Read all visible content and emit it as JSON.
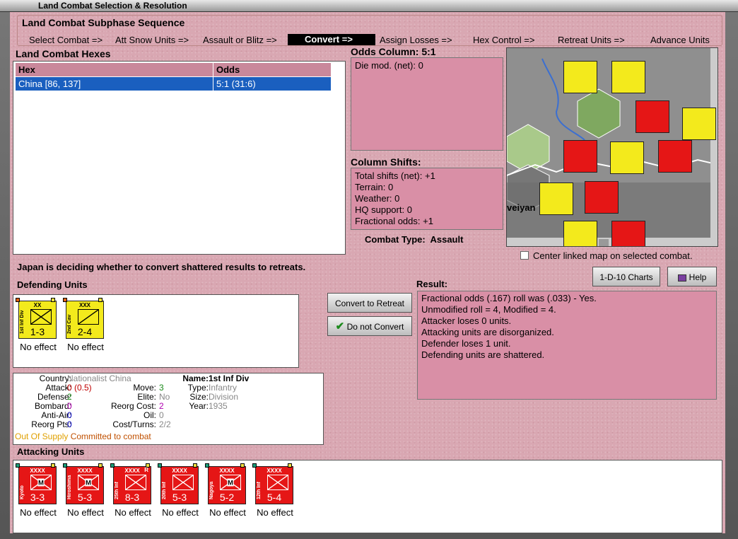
{
  "window": {
    "title": "Land Combat Selection & Resolution"
  },
  "sequence": {
    "title": "Land Combat Subphase Sequence",
    "steps": [
      "Select Combat =>",
      "Att Snow Units =>",
      "Assault or Blitz =>",
      "Convert =>",
      "Assign Losses =>",
      "Hex Control =>",
      "Retreat Units =>",
      "Advance Units"
    ],
    "current_index": 3
  },
  "hexes": {
    "title": "Land Combat Hexes",
    "col_hex": "Hex",
    "col_odds": "Odds",
    "rows": [
      {
        "hex": "China [86, 137]",
        "odds": "5:1 (31:6)"
      }
    ]
  },
  "odds": {
    "title": "Odds Column: 5:1",
    "die_mod": "Die mod. (net): 0"
  },
  "shifts": {
    "title": "Column Shifts:",
    "lines": [
      "Total shifts (net): +1",
      "Terrain: 0",
      "Weather: 0",
      "HQ support: 0",
      "Fractional odds: +1"
    ]
  },
  "combat_type": {
    "label": "Combat Type:",
    "value": "Assault"
  },
  "map": {
    "center_label": "Center linked map on selected combat.",
    "center_checked": false,
    "place_fragment": "veiyan"
  },
  "status_text": "Japan is deciding whether to convert shattered results to retreats.",
  "buttons": {
    "charts": "1-D-10 Charts",
    "help": "Help",
    "convert": "Convert to Retreat",
    "do_not_convert": "Do not Convert"
  },
  "defending": {
    "title": "Defending Units",
    "units": [
      {
        "name": "1st Inf Div",
        "size": "XX",
        "value": "1-3",
        "result": "No effect",
        "color": "yellow",
        "symbol": "inf"
      },
      {
        "name": "2nd Cav",
        "size": "XXX",
        "value": "2-4",
        "result": "No effect",
        "color": "yellow",
        "symbol": "cav"
      }
    ]
  },
  "details": {
    "country_label": "Country:",
    "country": "Nationalist China",
    "attack_label": "Attack:",
    "attack": "0 (0.5)",
    "defense_label": "Defense:",
    "defense": "2",
    "bombard_label": "Bombard:",
    "bombard": "0",
    "antiair_label": "Anti-Air:",
    "antiair": "0",
    "reorgpts_label": "Reorg Pts:",
    "reorgpts": "0",
    "move_label": "Move:",
    "move": "3",
    "elite_label": "Elite:",
    "elite": "No",
    "reorgcost_label": "Reorg Cost:",
    "reorgcost": "2",
    "oil_label": "Oil:",
    "oil": "0",
    "costturns_label": "Cost/Turns:",
    "costturns": "2/2",
    "name_label": "Name:",
    "name": "1st Inf Div",
    "type_label": "Type:",
    "type": "Infantry",
    "size_label": "Size:",
    "size": "Division",
    "year_label": "Year:",
    "year": "1935",
    "supply": "Out Of Supply",
    "committed": "Committed to combat"
  },
  "result": {
    "title": "Result:",
    "lines": [
      "Fractional odds (.167) roll was (.033)  - Yes.",
      "Unmodified roll = 4, Modified = 4.",
      "Attacker loses 0 units.",
      "Attacking units are disorganized.",
      "Defender loses 1 unit.",
      "Defending units are shattered."
    ]
  },
  "attacking": {
    "title": "Attacking Units",
    "units": [
      {
        "name": "Kyoto",
        "size": "XXXX",
        "value": "3-3",
        "result": "No effect",
        "symbol": "mech",
        "reserve": false
      },
      {
        "name": "Hiroshima",
        "size": "XXXX",
        "value": "5-3",
        "result": "No effect",
        "symbol": "mech",
        "reserve": false
      },
      {
        "name": "25th Inf",
        "size": "XXXX",
        "value": "8-3",
        "result": "No effect",
        "symbol": "inf",
        "reserve": true
      },
      {
        "name": "20th Inf",
        "size": "XXXX",
        "value": "5-3",
        "result": "No effect",
        "symbol": "inf",
        "reserve": false
      },
      {
        "name": "Nagoya",
        "size": "XXXX",
        "value": "5-2",
        "result": "No effect",
        "symbol": "mech",
        "reserve": false
      },
      {
        "name": "12th Inf",
        "size": "XXXX",
        "value": "5-4",
        "result": "No effect",
        "symbol": "inf",
        "reserve": false
      }
    ]
  },
  "colors": {
    "pink": "#d9a7b2",
    "counter_yellow": "#f3ea1c",
    "counter_red": "#e51616",
    "selection": "#1a5fbf"
  }
}
